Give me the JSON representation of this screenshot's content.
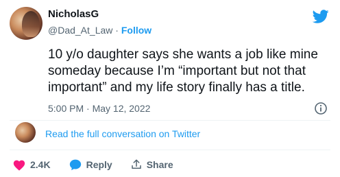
{
  "author": {
    "name": "NicholasG",
    "handle": "@Dad_At_Law",
    "separator": "·",
    "follow_label": "Follow"
  },
  "tweet": {
    "text": "10 y/o daughter says she wants a job like mine someday because I’m “important but not that important” and my life story finally has a title.",
    "timestamp": "5:00 PM · May 12, 2022"
  },
  "conversation": {
    "link_label": "Read the full conversation on Twitter"
  },
  "actions": {
    "likes": "2.4K",
    "reply_label": "Reply",
    "share_label": "Share"
  },
  "colors": {
    "accent": "#1d9bf0",
    "like": "#f91880",
    "text": "#0f1419",
    "muted": "#536471"
  },
  "icons": [
    "twitter-bird-icon",
    "info-icon",
    "heart-icon",
    "reply-icon",
    "share-icon"
  ]
}
